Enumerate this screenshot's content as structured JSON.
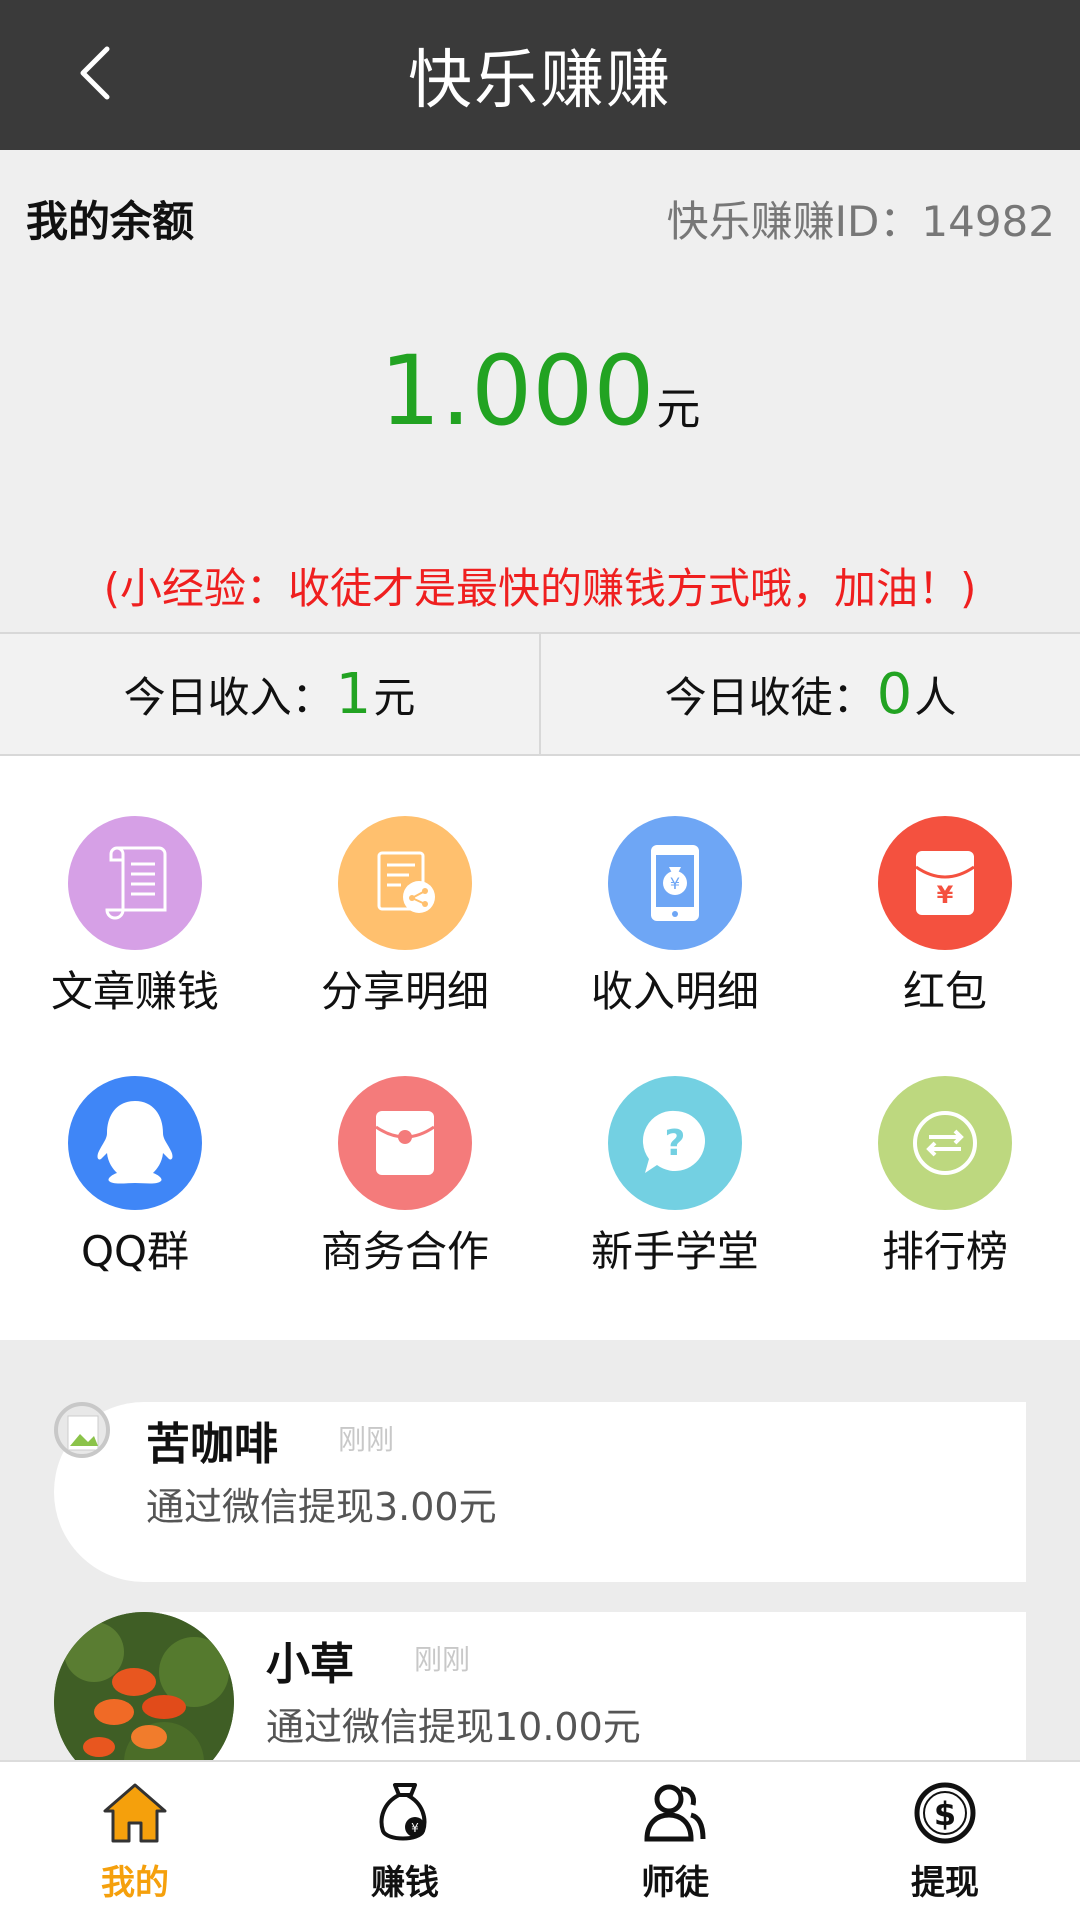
{
  "header": {
    "title": "快乐赚赚"
  },
  "balance": {
    "label": "我的余额",
    "id_text": "快乐赚赚ID：14982",
    "amount": "1.000",
    "unit": "元",
    "tip": "(小经验：收徒才是最快的赚钱方式哦，加油！)"
  },
  "today": {
    "income_label": "今日收入：",
    "income_value": "1",
    "income_unit": "元",
    "apprentice_label": "今日收徒：",
    "apprentice_value": "0",
    "apprentice_unit": "人"
  },
  "grid": [
    {
      "label": "文章赚钱",
      "icon": "scroll-icon",
      "color": "#d6a0e6"
    },
    {
      "label": "分享明细",
      "icon": "share-document-icon",
      "color": "#ffc06e"
    },
    {
      "label": "收入明细",
      "icon": "phone-money-icon",
      "color": "#6ea6f5"
    },
    {
      "label": "红包",
      "icon": "red-envelope-icon",
      "color": "#f4513f"
    },
    {
      "label": "QQ群",
      "icon": "qq-penguin-icon",
      "color": "#3f86f7"
    },
    {
      "label": "商务合作",
      "icon": "envelope-icon",
      "color": "#f47b7b"
    },
    {
      "label": "新手学堂",
      "icon": "question-bubble-icon",
      "color": "#73d0e2"
    },
    {
      "label": "排行榜",
      "icon": "exchange-arrows-icon",
      "color": "#bdd87f"
    }
  ],
  "feed": [
    {
      "name": "苦咖啡",
      "time": "刚刚",
      "text": "通过微信提现3.00元"
    },
    {
      "name": "小草",
      "time": "刚刚",
      "text": "通过微信提现10.00元"
    }
  ],
  "nav": [
    {
      "label": "我的",
      "icon": "home-icon",
      "active": true
    },
    {
      "label": "赚钱",
      "icon": "money-bag-icon",
      "active": false
    },
    {
      "label": "师徒",
      "icon": "users-icon",
      "active": false
    },
    {
      "label": "提现",
      "icon": "dollar-circle-icon",
      "active": false
    }
  ],
  "colors": {
    "header_bg": "#3a3a3a",
    "green": "#22a322",
    "red": "#ef1f1f",
    "orange": "#f5a00c"
  }
}
